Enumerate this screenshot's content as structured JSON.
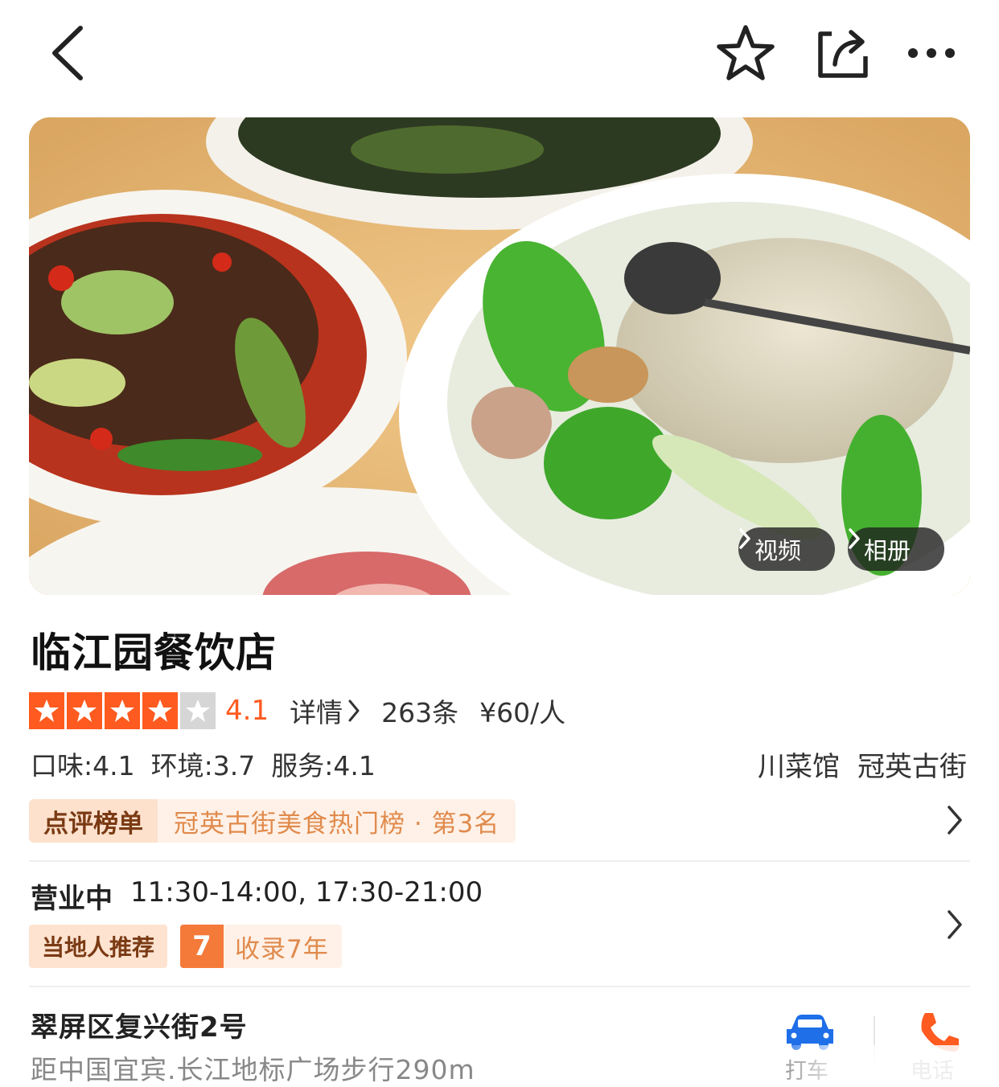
{
  "nav": {
    "back_icon": "chevron-left-icon",
    "favorite_icon": "star-outline-icon",
    "share_icon": "share-icon",
    "more_icon": "more-dots-icon"
  },
  "hero": {
    "video_label": "视频",
    "album_label": "相册"
  },
  "shop": {
    "name": "临江园餐饮店",
    "rating": {
      "stars_filled": 4,
      "stars_total": 5,
      "score": "4.1",
      "detail_label": "详情",
      "reviews": "263条",
      "price": "¥60/人"
    },
    "subscores": {
      "taste": "口味:4.1",
      "environment": "环境:3.7",
      "service": "服务:4.1"
    },
    "category": "川菜馆",
    "district": "冠英古街"
  },
  "ranking": {
    "label": "点评榜单",
    "text": "冠英古街美食热门榜 · 第3名"
  },
  "hours": {
    "status": "营业中",
    "times": "11:30-14:00, 17:30-21:00",
    "badge_local": "当地人推荐",
    "years_number": "7",
    "years_text": "收录7年"
  },
  "address": {
    "street": "翠屏区复兴街2号",
    "distance": "距中国宜宾.长江地标广场步行290m",
    "taxi_label": "打车",
    "phone_label": "电话"
  },
  "colors": {
    "accent": "#ff5a1f",
    "rank_bg": "#fff1e7",
    "rank_text": "#e08a4c",
    "taxi_blue": "#1e6fe8"
  }
}
